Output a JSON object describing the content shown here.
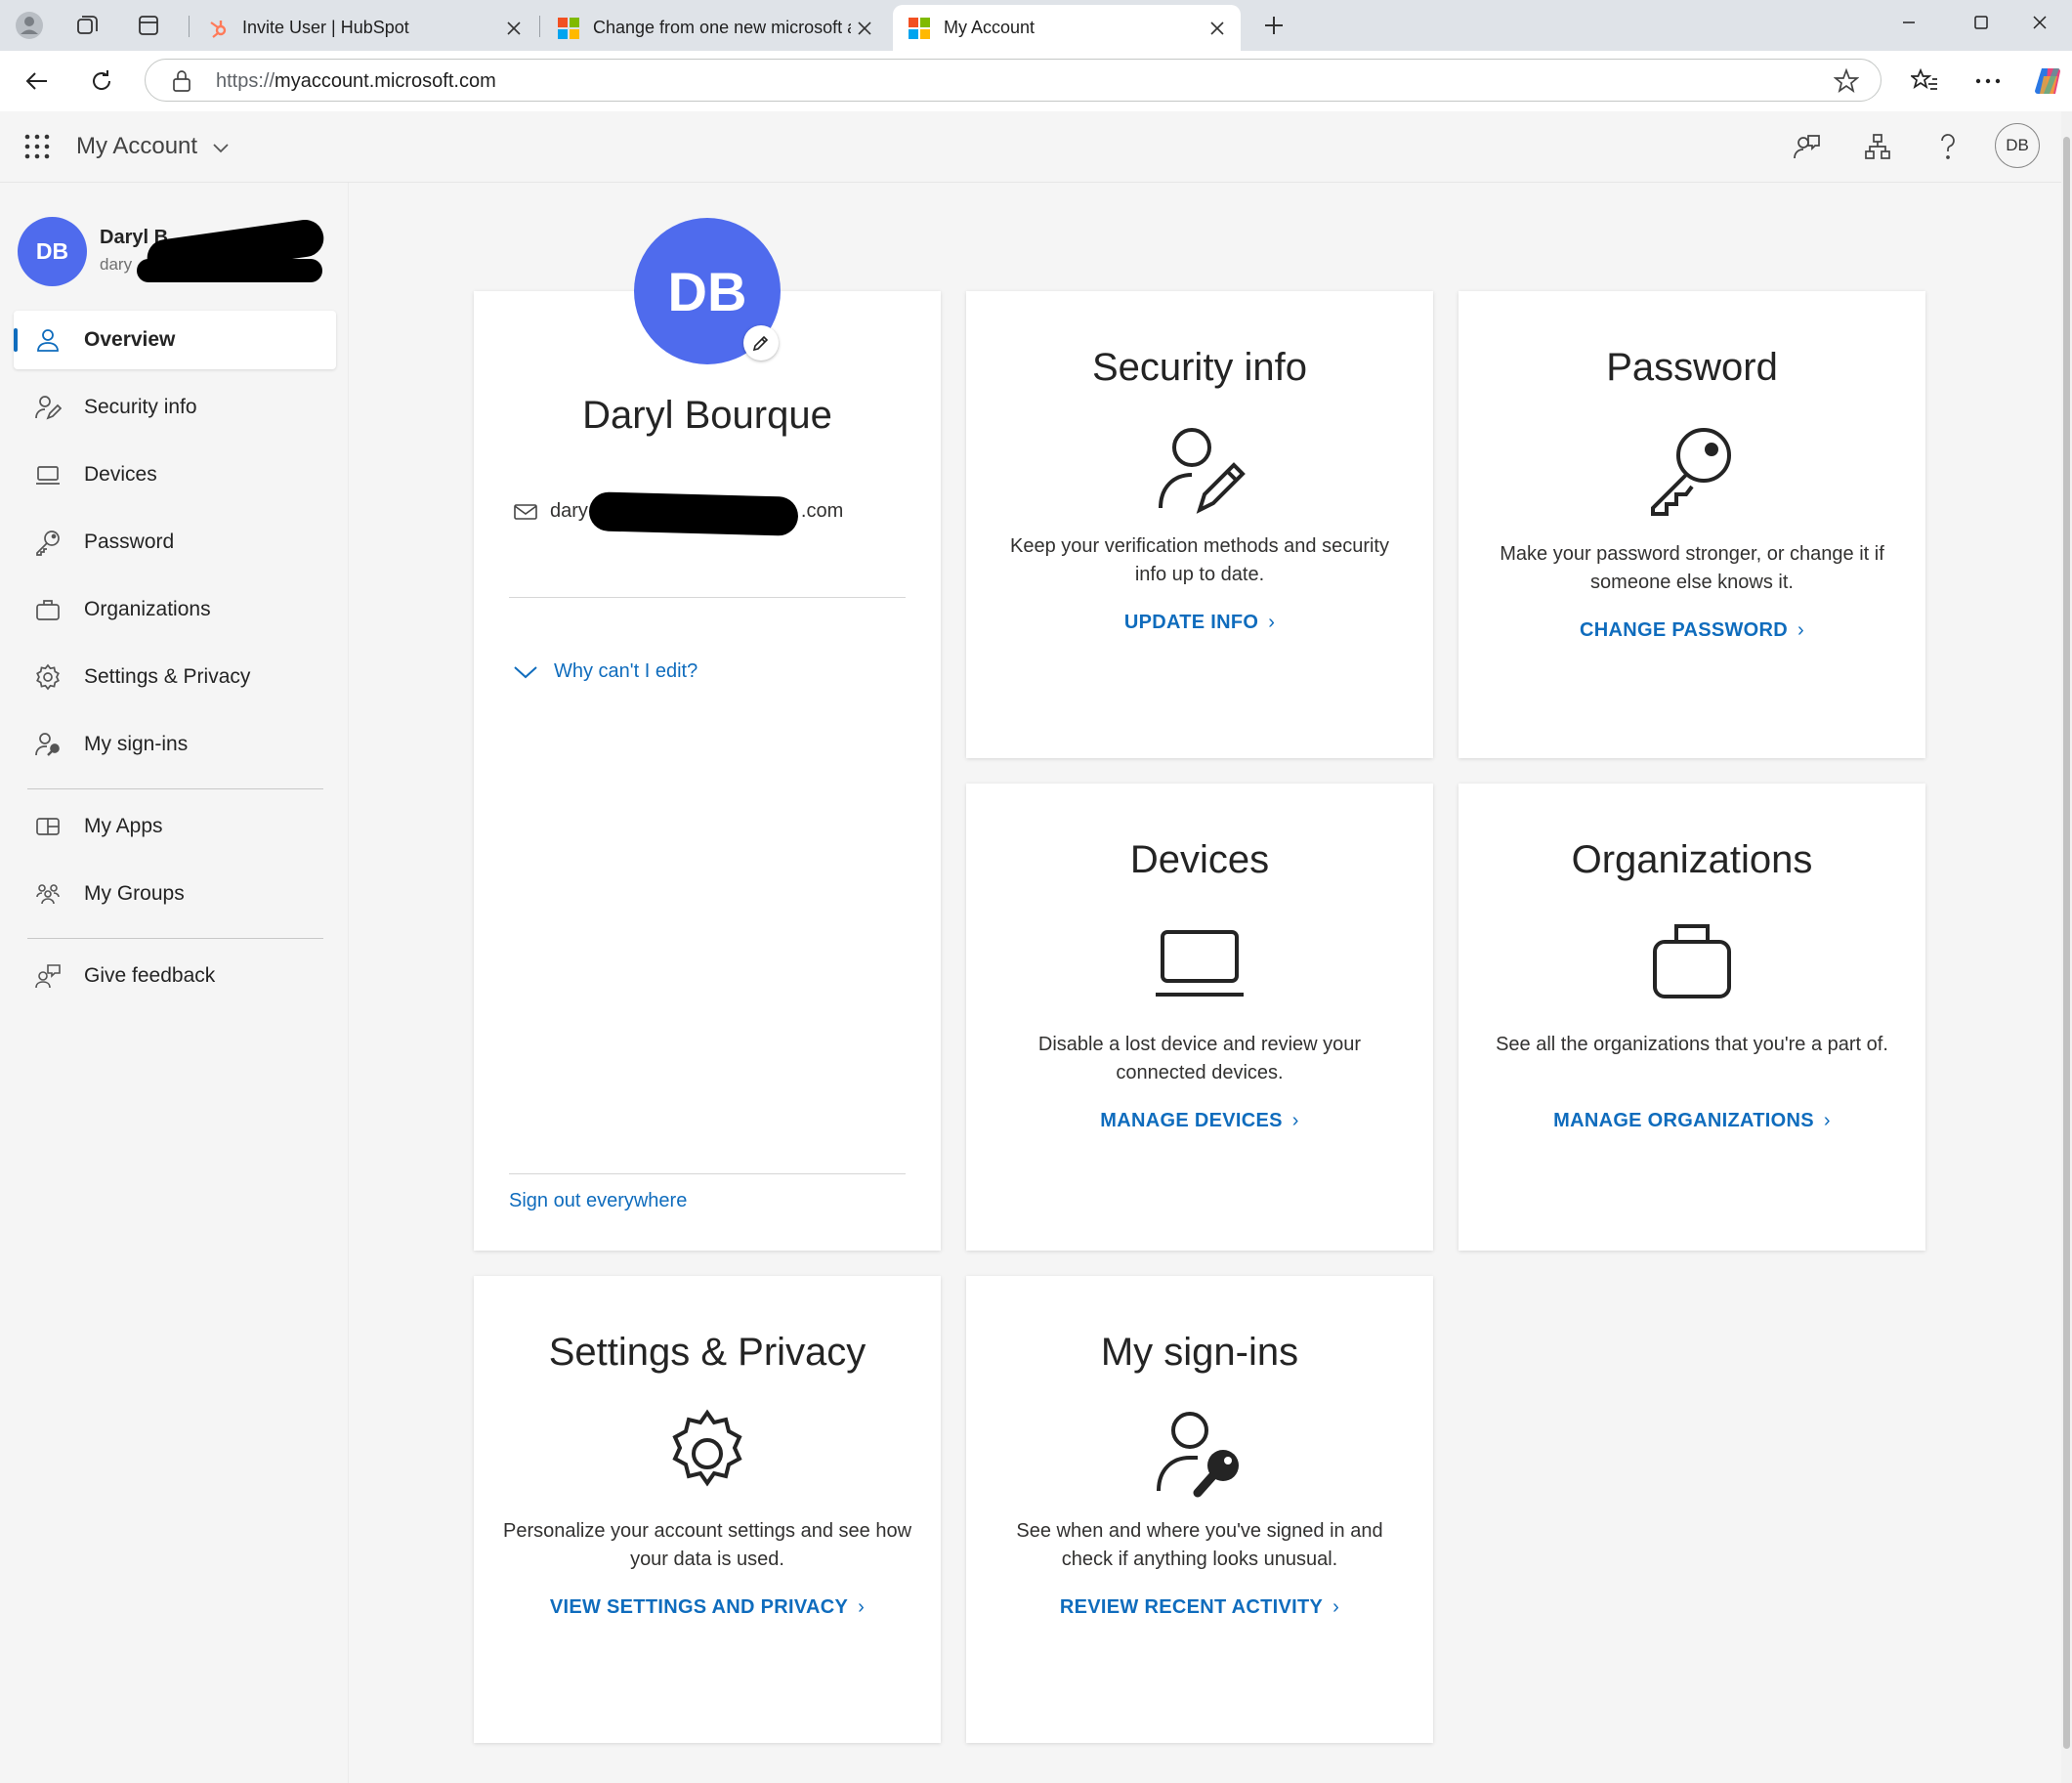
{
  "browser": {
    "tabs": [
      {
        "title": "Invite User | HubSpot",
        "active": false
      },
      {
        "title": "Change from one new microsoft a",
        "active": false
      },
      {
        "title": "My Account",
        "active": true
      }
    ],
    "url_scheme": "https://",
    "url_host": "myaccount.microsoft.com"
  },
  "header": {
    "app_title": "My Account",
    "avatar_initials": "DB"
  },
  "sidebar": {
    "avatar_initials": "DB",
    "user_name": "Daryl B",
    "user_email": "dary",
    "nav_primary": [
      {
        "label": "Overview",
        "icon": "person-icon",
        "active": true
      },
      {
        "label": "Security info",
        "icon": "security-info-icon"
      },
      {
        "label": "Devices",
        "icon": "laptop-icon"
      },
      {
        "label": "Password",
        "icon": "key-icon"
      },
      {
        "label": "Organizations",
        "icon": "briefcase-icon"
      },
      {
        "label": "Settings & Privacy",
        "icon": "gear-icon"
      },
      {
        "label": "My sign-ins",
        "icon": "sign-ins-icon"
      }
    ],
    "nav_apps": [
      {
        "label": "My Apps",
        "icon": "apps-icon"
      },
      {
        "label": "My Groups",
        "icon": "groups-icon"
      }
    ],
    "nav_feedback": [
      {
        "label": "Give feedback",
        "icon": "feedback-icon"
      }
    ]
  },
  "profile": {
    "initials": "DB",
    "name": "Daryl Bourque",
    "email_prefix": "dary",
    "email_suffix": ".com",
    "why_cant_edit": "Why can't I edit?",
    "sign_out": "Sign out everywhere"
  },
  "cards": {
    "security": {
      "title": "Security info",
      "desc": "Keep your verification methods and security info up to date.",
      "link": "UPDATE INFO"
    },
    "password": {
      "title": "Password",
      "desc": "Make your password stronger, or change it if someone else knows it.",
      "link": "CHANGE PASSWORD"
    },
    "devices": {
      "title": "Devices",
      "desc": "Disable a lost device and review your connected devices.",
      "link": "MANAGE DEVICES"
    },
    "organizations": {
      "title": "Organizations",
      "desc": "See all the organizations that you're a part of.",
      "link": "MANAGE ORGANIZATIONS"
    },
    "settings": {
      "title": "Settings & Privacy",
      "desc": "Personalize your account settings and see how your data is used.",
      "link": "VIEW SETTINGS AND PRIVACY"
    },
    "signins": {
      "title": "My sign-ins",
      "desc": "See when and where you've signed in and check if anything looks unusual.",
      "link": "REVIEW RECENT ACTIVITY"
    }
  },
  "colors": {
    "accent": "#0f6cbd",
    "avatar": "#4f6bed"
  }
}
